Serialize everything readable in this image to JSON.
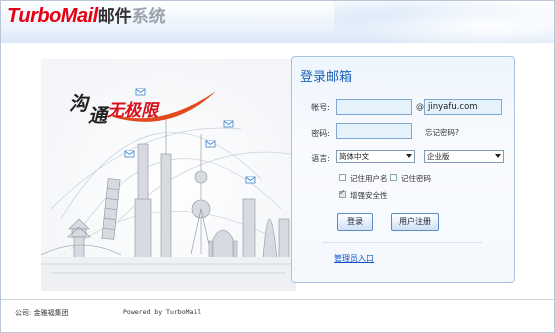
{
  "header": {
    "logo_brand": "TurboMail",
    "logo_mail": "邮件",
    "logo_system": "系统"
  },
  "slogan": {
    "part1": "沟",
    "part2": "通",
    "part3": "无极限"
  },
  "login": {
    "title": "登录邮箱",
    "account_label": "帐号:",
    "account_value": "",
    "at_sign": "@",
    "domain_value": "jinyafu.com",
    "password_label": "密码:",
    "password_value": "",
    "forgot_label": "忘记密码?",
    "language_label": "语言:",
    "language_value": "简体中文",
    "edition_value": "企业版",
    "remember_user_label": "记住用户名",
    "remember_password_label": "记住密码",
    "security_label": "增强安全性",
    "security_checked": true,
    "login_button": "登录",
    "register_button": "用户注册",
    "admin_link": "管理员入口"
  },
  "footer": {
    "company": "公司: 金雅福集团",
    "powered": "Powered by TurboMail"
  },
  "colors": {
    "brand_red": "#e60012",
    "title_blue": "#1c62b7",
    "link_blue": "#1155cc"
  }
}
